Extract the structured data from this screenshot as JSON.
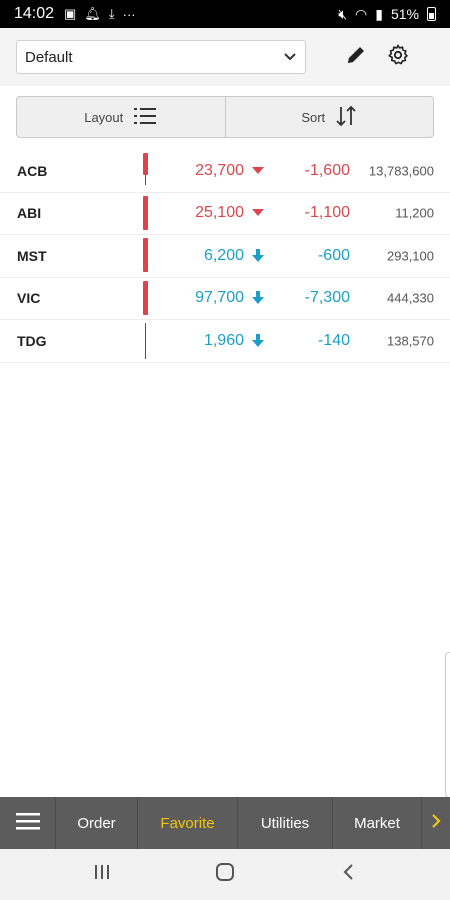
{
  "status_bar": {
    "time": "14:02",
    "battery": "51%"
  },
  "header": {
    "watchlist_selected": "Default",
    "icons": [
      "pencil-icon",
      "gear-icon",
      "chevron-down-icon"
    ]
  },
  "toolbar": {
    "layout_label": "Layout",
    "sort_label": "Sort"
  },
  "stocks": [
    {
      "symbol": "ACB",
      "price": "23,700",
      "change": "-1,600",
      "volume": "13,783,600",
      "direction": "down",
      "arrow_style": "triangle",
      "color": "#d9474f",
      "bar": "candle"
    },
    {
      "symbol": "ABI",
      "price": "25,100",
      "change": "-1,100",
      "volume": "11,200",
      "direction": "down",
      "arrow_style": "triangle",
      "color": "#d9474f",
      "bar": "candle"
    },
    {
      "symbol": "MST",
      "price": "6,200",
      "change": "-600",
      "volume": "293,100",
      "direction": "down",
      "arrow_style": "arrow",
      "color": "#1aa0c8",
      "bar": "candle"
    },
    {
      "symbol": "VIC",
      "price": "97,700",
      "change": "-7,300",
      "volume": "444,330",
      "direction": "down",
      "arrow_style": "arrow",
      "color": "#1aa0c8",
      "bar": "candle"
    },
    {
      "symbol": "TDG",
      "price": "1,960",
      "change": "-140",
      "volume": "138,570",
      "direction": "down",
      "arrow_style": "arrow",
      "color": "#1aa0c8",
      "bar": "line"
    }
  ],
  "bottom_nav": {
    "tabs": [
      {
        "label": "Order",
        "active": false
      },
      {
        "label": "Favorite",
        "active": true
      },
      {
        "label": "Utilities",
        "active": false
      },
      {
        "label": "Market",
        "active": false
      }
    ],
    "active_color": "#f2c414"
  }
}
